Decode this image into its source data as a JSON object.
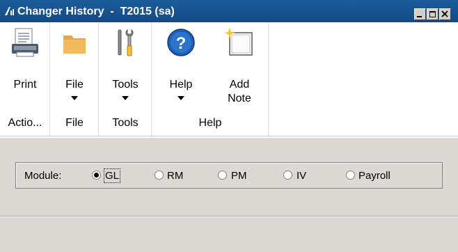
{
  "window": {
    "title": "Changer History  -  T2015 (sa)"
  },
  "ribbon": {
    "groups": [
      {
        "label": "Actio...",
        "buttons": [
          {
            "label": "Print",
            "icon": "print-icon"
          }
        ]
      },
      {
        "label": "File",
        "buttons": [
          {
            "label": "File",
            "icon": "folder-icon",
            "dropdown": true
          }
        ]
      },
      {
        "label": "Tools",
        "buttons": [
          {
            "label": "Tools",
            "icon": "tools-icon",
            "dropdown": true
          }
        ]
      },
      {
        "label": "Help",
        "buttons": [
          {
            "label": "Help",
            "icon": "help-icon",
            "dropdown": true
          },
          {
            "label": "Add\nNote",
            "icon": "add-note-icon"
          }
        ]
      }
    ]
  },
  "module": {
    "label": "Module:",
    "options": [
      {
        "label": "GL",
        "checked": true
      },
      {
        "label": "RM",
        "checked": false
      },
      {
        "label": "PM",
        "checked": false
      },
      {
        "label": "IV",
        "checked": false
      },
      {
        "label": "Payroll",
        "checked": false
      }
    ]
  }
}
